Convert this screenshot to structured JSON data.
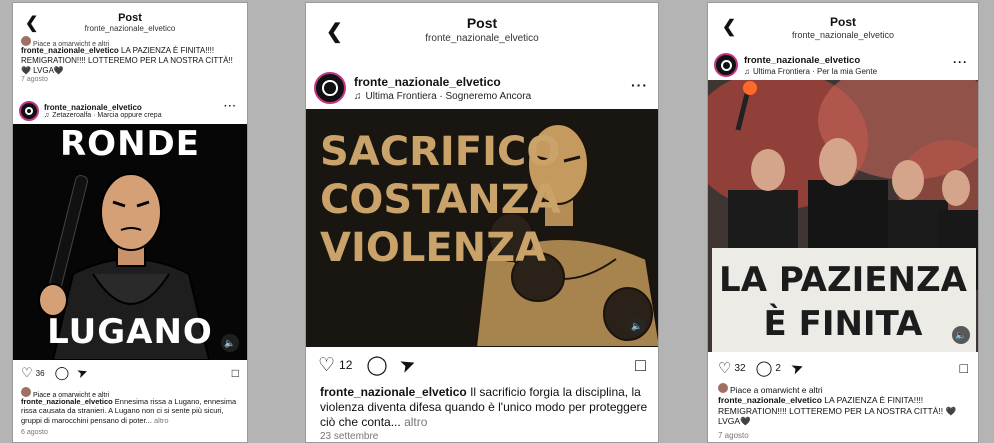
{
  "posts": [
    {
      "header": {
        "title": "Post",
        "subtitle": "fronte_nazionale_elvetico"
      },
      "prev": {
        "likes": "Piace a omarwicht e altri",
        "caption_user": "fronte_nazionale_elvetico",
        "caption": "LA PAZIENZA È FINITA!!!! REMIGRATION!!!! LOTTEREMO PER LA NOSTRA CITTÀ!! 🖤 LVGA🖤",
        "date": "7 agosto"
      },
      "username": "fronte_nazionale_elvetico",
      "music": "Zetazeroalfa · Marcia oppure crepa",
      "image": {
        "top_text": "RONDE",
        "bottom_text": "LUGANO"
      },
      "like_count": "36",
      "likes": "Piace a omarwicht e altri",
      "caption_user": "fronte_nazionale_elvetico",
      "caption": "Ennesima rissa a Lugano, ennesima rissa causata da stranieri. A Lugano non ci si sente più sicuri, gruppi di marocchini pensano di poter...",
      "more": "altro",
      "date": "6 agosto"
    },
    {
      "header": {
        "title": "Post",
        "subtitle": "fronte_nazionale_elvetico"
      },
      "username": "fronte_nazionale_elvetico",
      "music": "Ultima Frontiera · Sogneremo Ancora",
      "image": {
        "line1": "SACRIFICO",
        "line2": "COSTANZA",
        "line3": "VIOLENZA"
      },
      "like_count": "12",
      "caption_user": "fronte_nazionale_elvetico",
      "caption": "Il sacrificio forgia la disciplina, la violenza diventa difesa quando è l'unico modo per proteggere ciò che conta...",
      "more": "altro",
      "date": "23 settembre"
    },
    {
      "header": {
        "title": "Post",
        "subtitle": "fronte_nazionale_elvetico"
      },
      "username": "fronte_nazionale_elvetico",
      "music": "Ultima Frontiera · Per la mia Gente",
      "image": {
        "banner1": "LA PAZIENZA",
        "banner2": "È FINITA"
      },
      "like_count": "32",
      "comment_count": "2",
      "likes": "Piace a omarwicht e altri",
      "caption_user": "fronte_nazionale_elvetico",
      "caption": "LA PAZIENZA È FINITA!!!! REMIGRATION!!!! LOTTEREMO PER LA NOSTRA CITTÀ!! 🖤 LVGA🖤",
      "date": "7 agosto"
    }
  ]
}
